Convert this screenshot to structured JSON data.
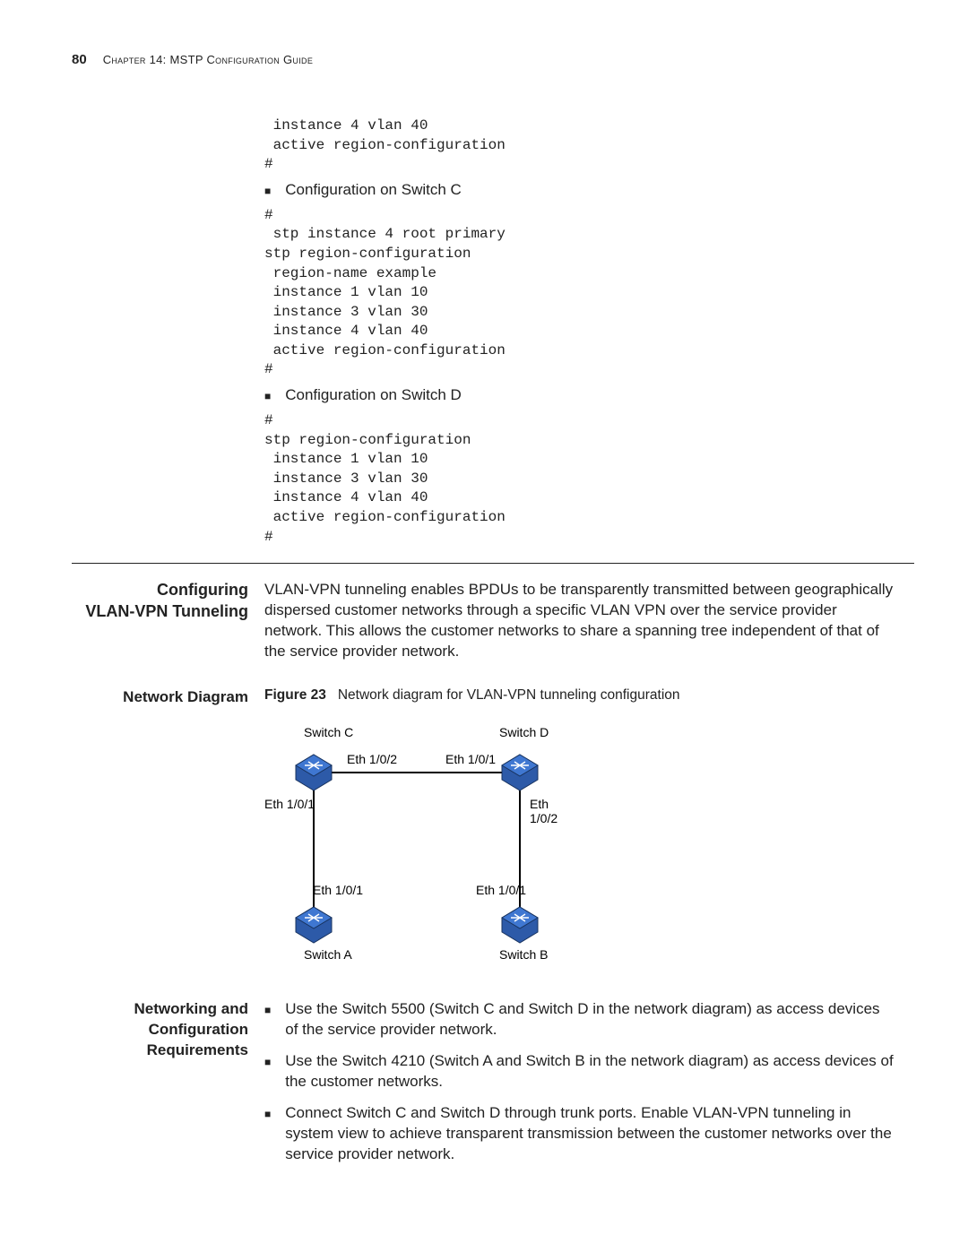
{
  "header": {
    "page_number": "80",
    "chapter_label": "Chapter 14:",
    "chapter_title": "MSTP Configuration Guide"
  },
  "top_code_block_1": " instance 4 vlan 40\n active region-configuration\n#",
  "bullet_switch_c": "Configuration on Switch C",
  "code_switch_c": "#\n stp instance 4 root primary\nstp region-configuration\n region-name example\n instance 1 vlan 10\n instance 3 vlan 30\n instance 4 vlan 40\n active region-configuration\n#",
  "bullet_switch_d": "Configuration on Switch D",
  "code_switch_d": "#\nstp region-configuration\n instance 1 vlan 10\n instance 3 vlan 30\n instance 4 vlan 40\n active region-configuration\n#",
  "section": {
    "title_line1": "Configuring",
    "title_line2": "VLAN-VPN Tunneling",
    "intro": "VLAN-VPN tunneling enables BPDUs to be transparently transmitted between geographically dispersed customer networks through a specific VLAN VPN over the service provider network. This allows the customer networks to share a spanning tree independent of that of the service provider network."
  },
  "network_diagram": {
    "heading": "Network Diagram",
    "figure_label": "Figure 23",
    "figure_caption": "Network diagram for VLAN-VPN tunneling configuration",
    "labels": {
      "switch_c": "Switch C",
      "switch_d": "Switch D",
      "switch_a": "Switch A",
      "switch_b": "Switch B",
      "eth_c_top": "Eth 1/0/2",
      "eth_d_top": "Eth 1/0/1",
      "eth_c_side": "Eth 1/0/1",
      "eth_d_side": "Eth 1/0/2",
      "eth_a_top": "Eth 1/0/1",
      "eth_b_top": "Eth 1/0/1"
    }
  },
  "requirements": {
    "heading_line1": "Networking and",
    "heading_line2": "Configuration",
    "heading_line3": "Requirements",
    "items": [
      "Use the Switch 5500 (Switch C and Switch D in the network diagram) as access devices of the service provider network.",
      "Use the Switch 4210 (Switch A and Switch B in the network diagram) as access devices of the customer networks.",
      "Connect Switch C and Switch D through trunk ports. Enable VLAN-VPN tunneling in system view to achieve transparent transmission between the customer networks over the service provider network."
    ]
  }
}
